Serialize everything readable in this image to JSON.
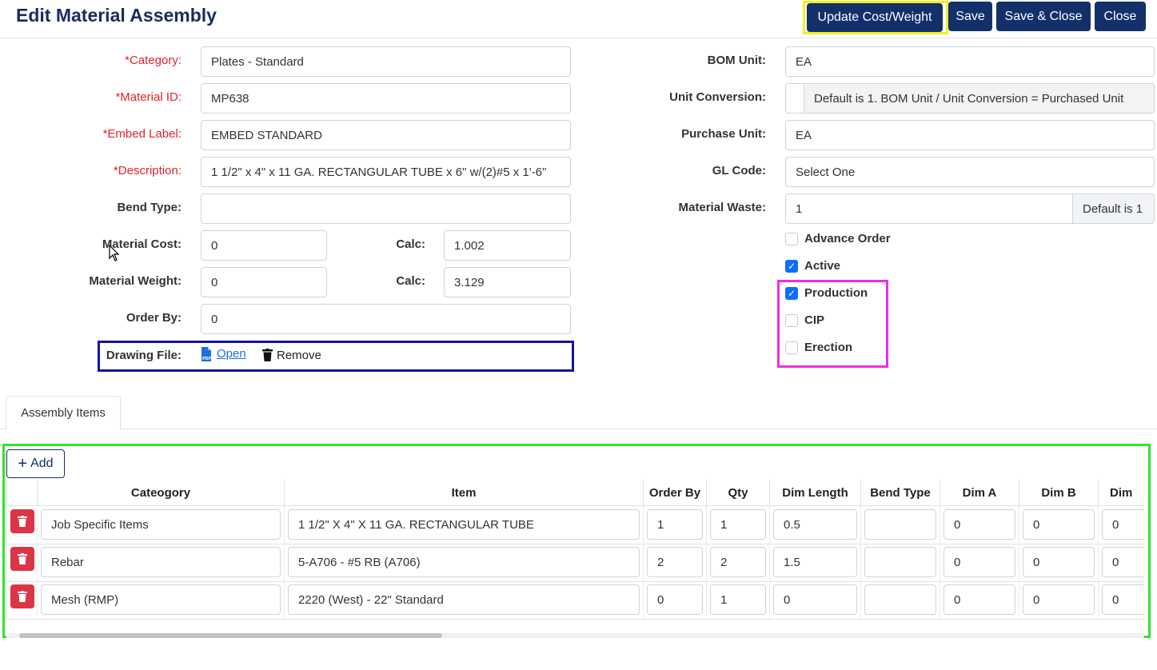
{
  "header": {
    "title": "Edit Material Assembly",
    "update_cost_label": "Update Cost/Weight",
    "save_label": "Save",
    "save_close_label": "Save & Close",
    "close_label": "Close"
  },
  "left_form": {
    "category": {
      "label": "*Category:",
      "value": "Plates - Standard"
    },
    "material_id": {
      "label": "*Material ID:",
      "value": "MP638"
    },
    "embed_label": {
      "label": "*Embed Label:",
      "value": "EMBED STANDARD"
    },
    "description": {
      "label": "*Description:",
      "value": "1 1/2\" x 4\" x 11 GA. RECTANGULAR TUBE x 6\" w/(2)#5 x 1'-6\""
    },
    "bend_type": {
      "label": "Bend Type:",
      "value": ""
    },
    "material_cost": {
      "label": "Material Cost:",
      "value": "0",
      "calc_label": "Calc:",
      "calc_value": "1.002"
    },
    "material_weight": {
      "label": "Material Weight:",
      "value": "0",
      "calc_label": "Calc:",
      "calc_value": "3.129"
    },
    "order_by": {
      "label": "Order By:",
      "value": "0"
    },
    "drawing_file": {
      "label": "Drawing File:",
      "open_label": "Open",
      "remove_label": "Remove"
    }
  },
  "right_form": {
    "bom_unit": {
      "label": "BOM Unit:",
      "value": "EA"
    },
    "unit_conversion": {
      "label": "Unit Conversion:",
      "value": "",
      "hint": "Default is 1. BOM Unit / Unit Conversion = Purchased Unit"
    },
    "purchase_unit": {
      "label": "Purchase Unit:",
      "value": "EA"
    },
    "gl_code": {
      "label": "GL Code:",
      "value": "Select One"
    },
    "material_waste": {
      "label": "Material Waste:",
      "value": "1",
      "hint": "Default is 1"
    },
    "checkboxes": {
      "advance_order": {
        "label": "Advance Order",
        "checked": false
      },
      "active": {
        "label": "Active",
        "checked": true
      },
      "production": {
        "label": "Production",
        "checked": true
      },
      "cip": {
        "label": "CIP",
        "checked": false
      },
      "erection": {
        "label": "Erection",
        "checked": false
      }
    }
  },
  "tabs": {
    "assembly_items": "Assembly Items"
  },
  "grid": {
    "add_label": "Add",
    "columns": [
      "Cateogory",
      "Item",
      "Order By",
      "Qty",
      "Dim Length",
      "Bend Type",
      "Dim A",
      "Dim B",
      "Dim"
    ],
    "rows": [
      {
        "category": "Job Specific Items",
        "item": "1 1/2\" X 4\" X 11 GA. RECTANGULAR TUBE",
        "order_by": "1",
        "qty": "1",
        "dim_length": "0.5",
        "bend_type": "",
        "dim_a": "0",
        "dim_b": "0",
        "dim_c": "0"
      },
      {
        "category": "Rebar",
        "item": "5-A706 - #5 RB (A706)",
        "order_by": "2",
        "qty": "2",
        "dim_length": "1.5",
        "bend_type": "",
        "dim_a": "0",
        "dim_b": "0",
        "dim_c": "0"
      },
      {
        "category": "Mesh (RMP)",
        "item": "2220 (West) - 22\" Standard",
        "order_by": "0",
        "qty": "1",
        "dim_length": "0",
        "bend_type": "",
        "dim_a": "0",
        "dim_b": "0",
        "dim_c": "0"
      }
    ]
  },
  "colors": {
    "primary_dark": "#13306b",
    "required_red": "#e0242a",
    "checkbox_blue": "#0d6efd",
    "delete_red": "#dc3545",
    "highlight_yellow": "#f4ef1e",
    "highlight_blue": "#1414a0",
    "highlight_magenta": "#f02ce6",
    "highlight_green": "#31e52c"
  }
}
